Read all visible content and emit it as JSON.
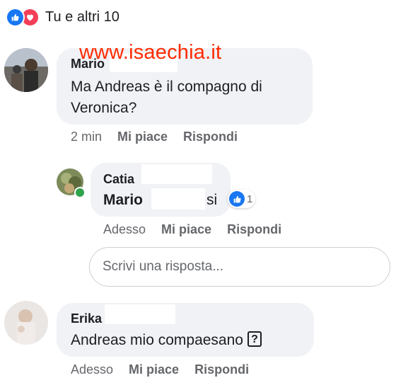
{
  "reactions": {
    "summary": "Tu e altri 10",
    "types": [
      "like-icon",
      "love-icon"
    ],
    "colors": {
      "like": "#1877f2",
      "love": "#f33e58"
    }
  },
  "watermark": "www.isaechia.it",
  "comments": [
    {
      "author": "Mario",
      "text_line1": "Ma Andreas è il compagno di",
      "text_line2": "Veronica?",
      "time": "2 min",
      "like": "Mi piace",
      "reply": "Rispondi"
    },
    {
      "author": "Catia",
      "mention": "Mario",
      "text_suffix": "si",
      "like_count": "1",
      "time": "Adesso",
      "like": "Mi piace",
      "reply": "Rispondi"
    },
    {
      "author": "Erika",
      "text": "Andreas mio compaesano",
      "emoji_symbol": "?",
      "time": "Adesso",
      "like": "Mi piace",
      "reply": "Rispondi"
    }
  ],
  "reply_box": {
    "placeholder": "Scrivi una risposta..."
  }
}
